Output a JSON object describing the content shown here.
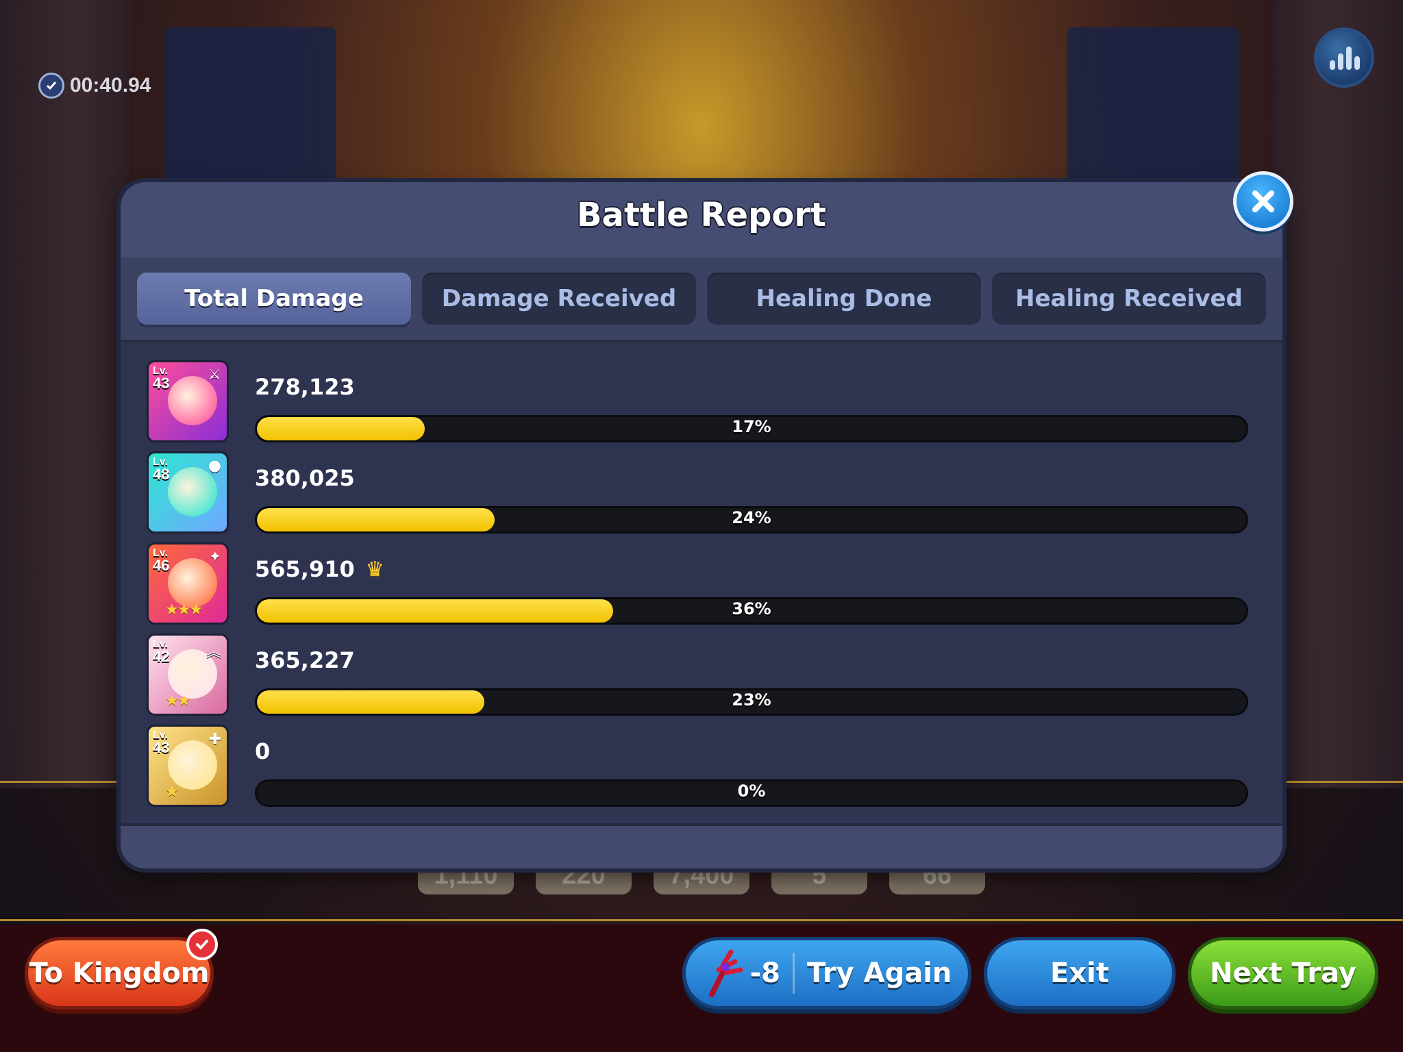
{
  "timer": {
    "elapsed": "00:40.94"
  },
  "modal": {
    "title": "Battle Report",
    "tabs": [
      {
        "label": "Total Damage",
        "active": true
      },
      {
        "label": "Damage Received",
        "active": false
      },
      {
        "label": "Healing Done",
        "active": false
      },
      {
        "label": "Healing Received",
        "active": false
      }
    ]
  },
  "cookies": [
    {
      "level_prefix": "Lv.",
      "level": "43",
      "value": "278,123",
      "percent_label": "17%",
      "percent": 17,
      "colors": [
        "#ff4d9a",
        "#8a2fd6"
      ],
      "stars": "",
      "top": false
    },
    {
      "level_prefix": "Lv.",
      "level": "48",
      "value": "380,025",
      "percent_label": "24%",
      "percent": 24,
      "colors": [
        "#2ee6d0",
        "#6fa8ff"
      ],
      "stars": "",
      "top": false
    },
    {
      "level_prefix": "Lv.",
      "level": "46",
      "value": "565,910",
      "percent_label": "36%",
      "percent": 36,
      "colors": [
        "#ff6a3a",
        "#e02a9a"
      ],
      "stars": "★★★",
      "top": true
    },
    {
      "level_prefix": "Lv.",
      "level": "42",
      "value": "365,227",
      "percent_label": "23%",
      "percent": 23,
      "colors": [
        "#ffe2ef",
        "#d96aa0"
      ],
      "stars": "★★",
      "top": false
    },
    {
      "level_prefix": "Lv.",
      "level": "43",
      "value": "0",
      "percent_label": "0%",
      "percent": 0,
      "colors": [
        "#ffe38a",
        "#c9932a"
      ],
      "stars": "★",
      "top": false
    }
  ],
  "bottom_buttons": {
    "to_kingdom": "To Kingdom",
    "try_again_cost": "-8",
    "try_again": "Try Again",
    "exit": "Exit",
    "next_tray": "Next Tray"
  },
  "background_chips": [
    "1,110",
    "220",
    "7,400",
    "5",
    "66"
  ],
  "colors": {
    "bar_fill": "#f2c200",
    "modal_bg": "#2f3552",
    "header_bg": "#454d72"
  }
}
